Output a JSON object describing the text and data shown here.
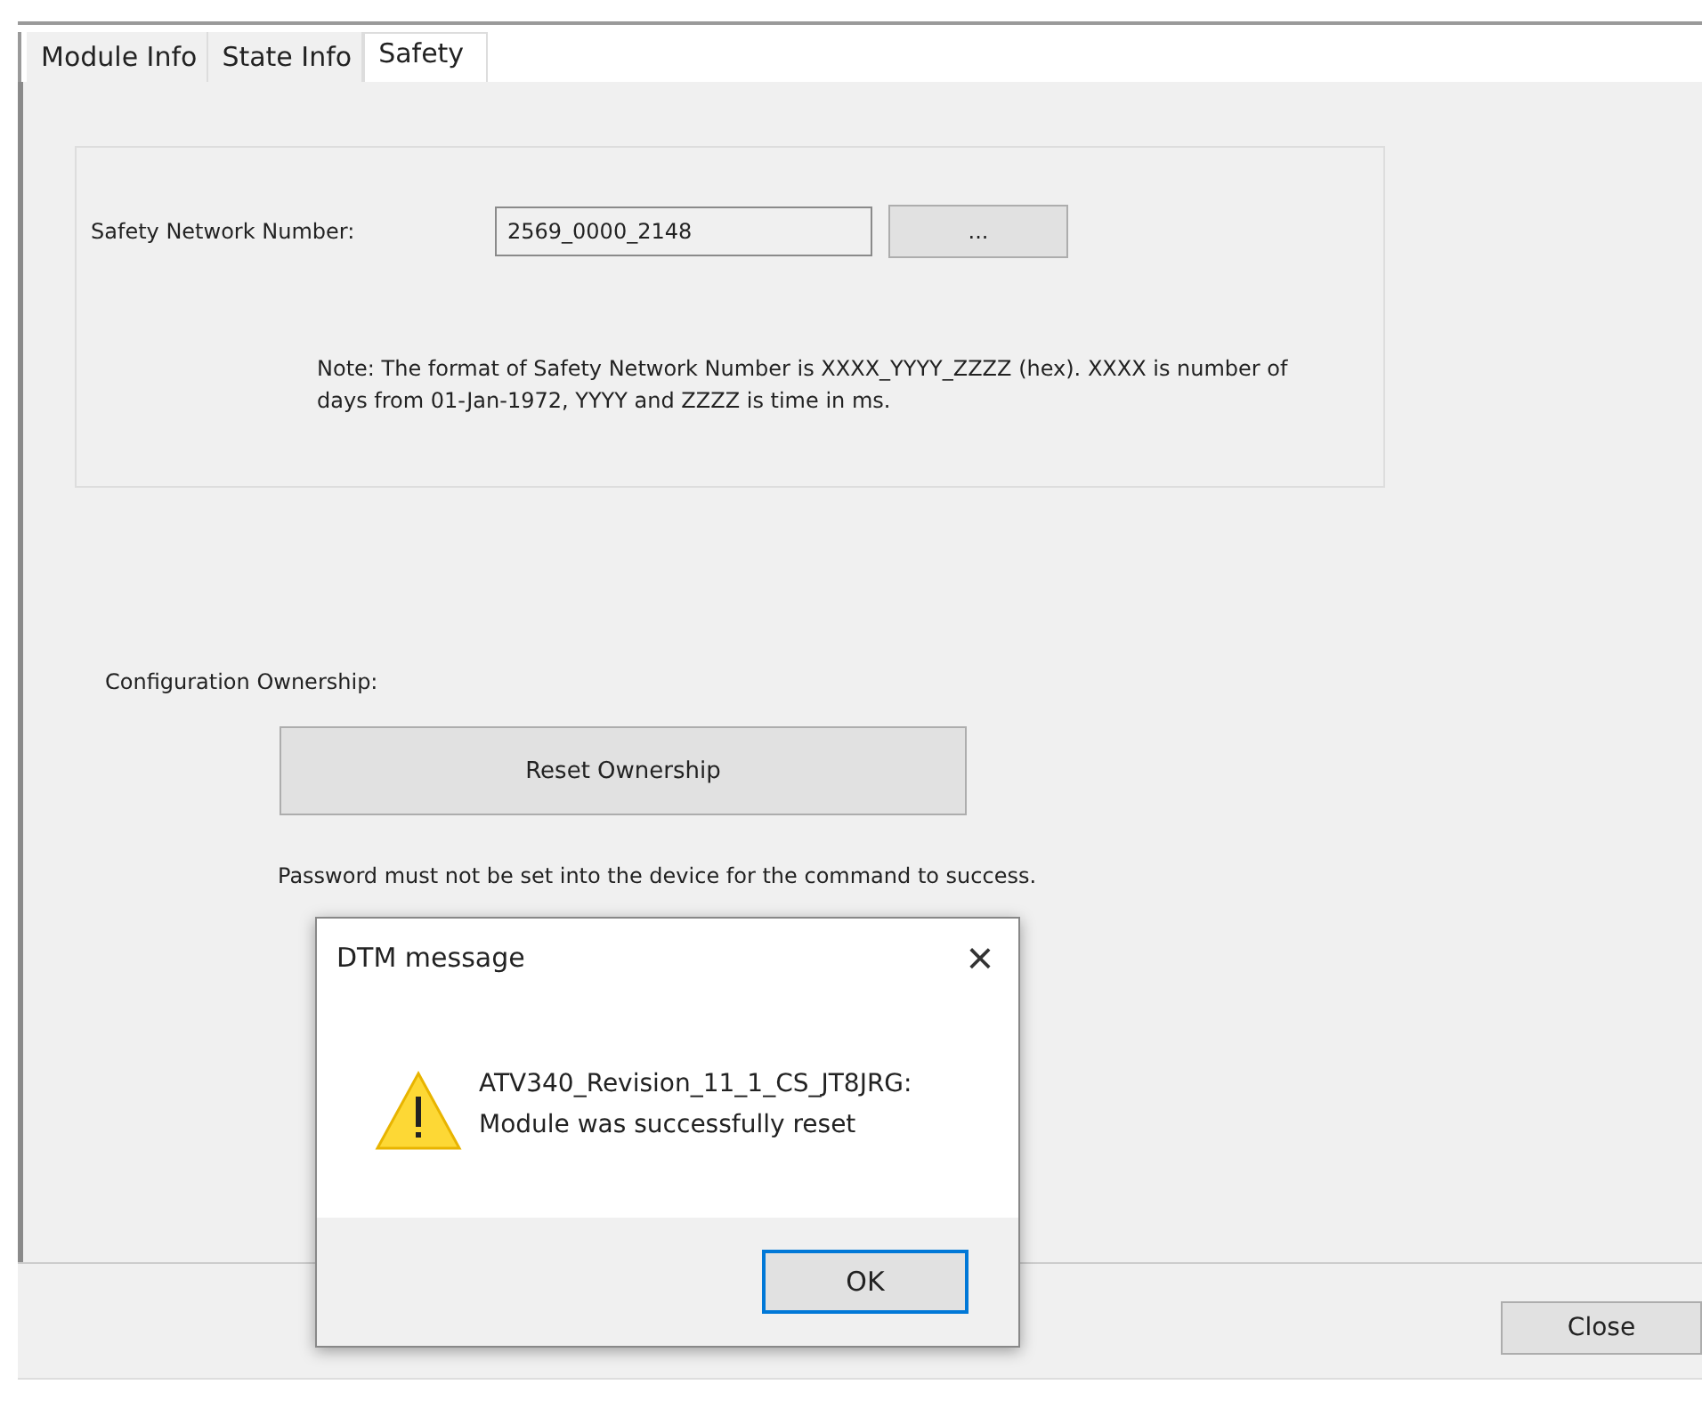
{
  "tabs": [
    {
      "label": "Module Info",
      "selected": false
    },
    {
      "label": "State Info",
      "selected": false
    },
    {
      "label": "Safety",
      "selected": true
    }
  ],
  "safety_network": {
    "label": "Safety Network Number:",
    "value": "2569_0000_2148",
    "browse_button": "...",
    "note": "Note: The format of Safety Network Number is XXXX_YYYY_ZZZZ (hex). XXXX is number of days from 01-Jan-1972, YYYY and ZZZZ is time in ms."
  },
  "ownership": {
    "label": "Configuration Ownership:",
    "button": "Reset Ownership",
    "hint": "Password must not be set into the device for the command to success."
  },
  "dialog": {
    "title": "DTM message",
    "close": "×",
    "message_lines": [
      "ATV340_Revision_11_1_CS_JT8JRG:",
      "Module was successfully reset"
    ],
    "ok_button": "OK"
  },
  "close_button": "Close"
}
